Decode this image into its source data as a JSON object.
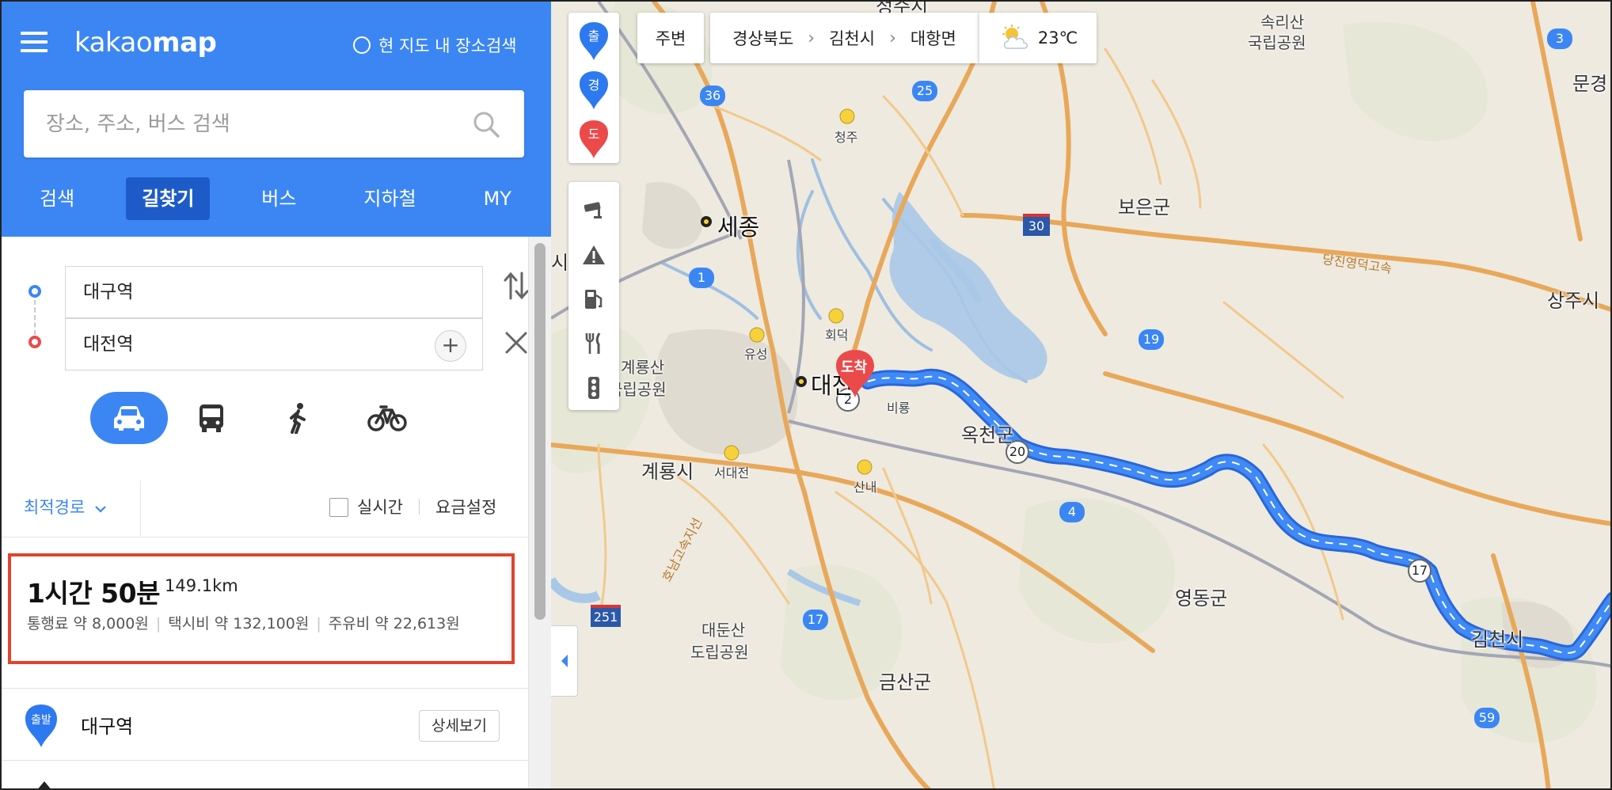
{
  "app": {
    "logo_left": "kakao",
    "logo_right": "map",
    "current_map_search": "현 지도 내 장소검색"
  },
  "search": {
    "placeholder": "장소, 주소, 버스 검색"
  },
  "tabs": [
    {
      "label": "검색"
    },
    {
      "label": "길찾기",
      "active": true
    },
    {
      "label": "버스"
    },
    {
      "label": "지하철"
    },
    {
      "label": "MY"
    }
  ],
  "route": {
    "origin": "대구역",
    "destination": "대전역",
    "add_waypoint": "+"
  },
  "modes": [
    {
      "name": "car",
      "icon": "car-icon",
      "active": true
    },
    {
      "name": "bus",
      "icon": "bus-icon"
    },
    {
      "name": "walk",
      "icon": "walk-icon"
    },
    {
      "name": "bike",
      "icon": "bike-icon"
    }
  ],
  "options": {
    "route_type": "최적경로",
    "realtime": "실시간",
    "realtime_checked": false,
    "fare_setting": "요금설정"
  },
  "result": {
    "time": "1시간 50분",
    "distance": "149.1km",
    "toll": "통행료 약 8,000원",
    "taxi": "택시비 약 132,100원",
    "fuel": "주유비 약 22,613원"
  },
  "steps": {
    "start_badge": "출발",
    "start_name": "대구역",
    "detail_button": "상세보기"
  },
  "map": {
    "around": "주변",
    "breadcrumb": [
      "경상북도",
      "김천시",
      "대항면"
    ],
    "temperature": "23℃",
    "pins": {
      "start": "출",
      "waypoint": "경",
      "end": "도"
    },
    "dest_marker": "도착",
    "colors": {
      "brand": "#3b86f3",
      "route": "#3b86f3",
      "dest": "#ea4a4a",
      "highlight": "#e1432d"
    },
    "place_labels": {
      "sejong": "세종",
      "boeun": "보은군",
      "daejeon": "대전",
      "gyeryong": "계룡시",
      "yeongdong": "영동군",
      "geumsan": "금산군",
      "sangju": "상주시",
      "gimcheon": "김천시",
      "mungyeong": "문경",
      "songnisan1": "속리산",
      "songnisan2": "국립공원",
      "gyeryongsan1": "계룡산",
      "gyeryongsan2": "국립공원",
      "daedunsan1": "대둔산",
      "daedunsan2": "도립공원",
      "okcheon": "옥천군",
      "cheongju": "청주",
      "hoedeok": "회덕",
      "yuseong": "유성",
      "seodaejeon": "서대전",
      "sannae": "산내",
      "biryong": "비룡",
      "danjin_expwy": "당진영덕고속",
      "honam_expwy": "호남고속지선",
      "north_top": "청주시",
      "si_left": "시"
    },
    "road_shields": [
      "36",
      "25",
      "30",
      "1",
      "19",
      "20",
      "4",
      "17",
      "17",
      "59",
      "251",
      "3",
      "2"
    ]
  }
}
